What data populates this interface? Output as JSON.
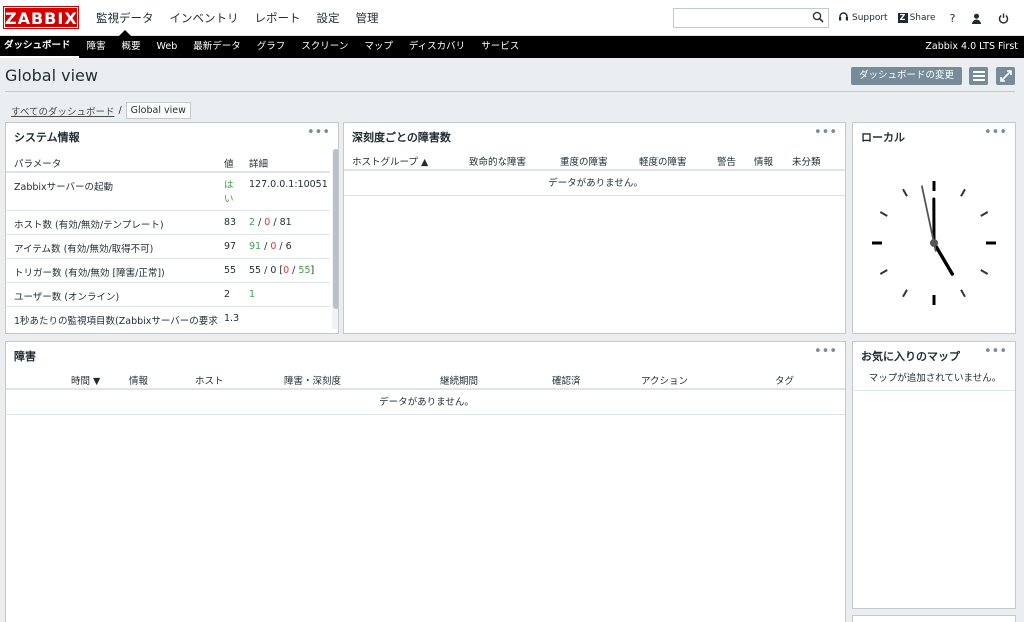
{
  "header": {
    "logo": "ZABBIX",
    "main_menu": [
      {
        "label": "監視データ",
        "selected": true
      },
      {
        "label": "インベントリ"
      },
      {
        "label": "レポート"
      },
      {
        "label": "設定"
      },
      {
        "label": "管理"
      }
    ],
    "search_placeholder": "",
    "support_label": "Support",
    "share_label": "Share",
    "help_label": "?"
  },
  "submenu": {
    "items": [
      "ダッシュボード",
      "障害",
      "概要",
      "Web",
      "最新データ",
      "グラフ",
      "スクリーン",
      "マップ",
      "ディスカバリ",
      "サービス"
    ],
    "brand": "Zabbix 4.0 LTS First"
  },
  "page": {
    "title": "Global view",
    "edit_button": "ダッシュボードの変更",
    "breadcrumb_all": "すべてのダッシュボード",
    "breadcrumb_sep": "/",
    "breadcrumb_current": "Global view"
  },
  "sysinfo": {
    "title": "システム情報",
    "headers": {
      "param": "パラメータ",
      "value": "値",
      "details": "詳細"
    },
    "rows": [
      {
        "param": "Zabbixサーバーの起動",
        "value": "はい",
        "details": "127.0.0.1:10051"
      },
      {
        "param": "ホスト数 (有効/無効/テンプレート)",
        "value": "83",
        "d1": "2",
        "d2": "0",
        "d3": "81"
      },
      {
        "param": "アイテム数 (有効/無効/取得不可)",
        "value": "97",
        "d1": "91",
        "d2": "0",
        "d3": "6"
      },
      {
        "param": "トリガー数 (有効/無効 [障害/正常])",
        "value": "55",
        "d1": "55 / 0 [",
        "d2": "0",
        "d3": "55",
        "d4": "]"
      },
      {
        "param": "ユーザー数 (オンライン)",
        "value": "2",
        "d1": "1"
      },
      {
        "param": "1秒あたりの監視項目数(Zabbixサーバーの要求",
        "value": "1.3"
      }
    ]
  },
  "severity": {
    "title": "深刻度ごとの障害数",
    "headers": [
      "ホストグループ ▲",
      "致命的な障害",
      "重度の障害",
      "軽度の障害",
      "警告",
      "情報",
      "未分類"
    ],
    "no_data": "データがありません。"
  },
  "clock": {
    "title": "ローカル",
    "hour": 4,
    "minute": 59,
    "second": 58
  },
  "problems": {
    "title": "障害",
    "headers": [
      "時間 ▼",
      "情報",
      "ホスト",
      "障害・深刻度",
      "継続期間",
      "確認済",
      "アクション",
      "タグ"
    ],
    "no_data": "データがありません。"
  },
  "favmaps": {
    "title": "お気に入りのマップ",
    "message": "マップが追加されていません。"
  },
  "widget_menu": "•••"
}
